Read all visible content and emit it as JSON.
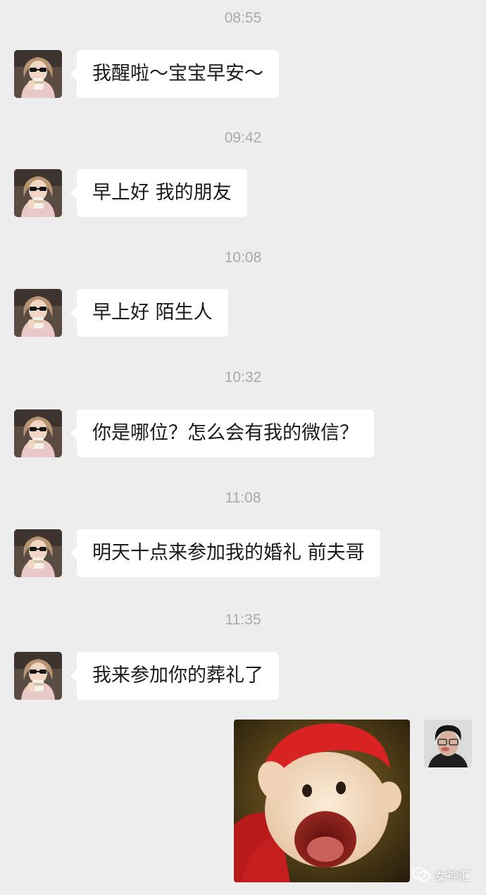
{
  "chat": {
    "messages": [
      {
        "time": "08:55",
        "text": "我醒啦～宝宝早安～"
      },
      {
        "time": "09:42",
        "text": "早上好 我的朋友"
      },
      {
        "time": "10:08",
        "text": "早上好 陌生人"
      },
      {
        "time": "10:32",
        "text": "你是哪位？怎么会有我的微信？"
      },
      {
        "time": "11:08",
        "text": "明天十点来参加我的婚礼 前夫哥"
      },
      {
        "time": "11:35",
        "text": "我来参加你的葬礼了"
      }
    ],
    "reply": {
      "type": "sticker",
      "icon": "screaming-pig-sticker"
    }
  },
  "watermark": {
    "text": "女神汇",
    "icon": "wechat-official-account-icon"
  },
  "colors": {
    "background": "#ededed",
    "bubble": "#ffffff",
    "timestamp": "#a9a9a9",
    "text": "#1a1a1a"
  }
}
